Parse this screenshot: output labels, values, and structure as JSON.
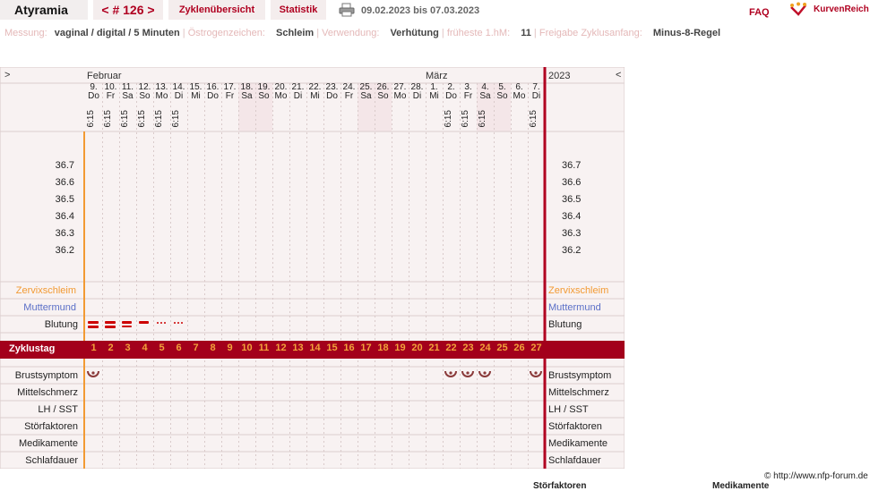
{
  "header": {
    "username": "Atyramia",
    "cycle_label": "< # 126 >",
    "nav_overview": "Zyklenübersicht",
    "nav_stats": "Statistik",
    "date_range": "09.02.2023 bis 07.03.2023",
    "faq": "FAQ",
    "brand": "KurvenReich"
  },
  "meta": [
    {
      "label": "Messung:",
      "value": "vaginal / digital / 5 Minuten"
    },
    {
      "label": "Östrogenzeichen:",
      "value": "Schleim"
    },
    {
      "label": "Verwendung:",
      "value": "Verhütung"
    },
    {
      "label": "früheste 1.hM:",
      "value": "11"
    },
    {
      "label": "Freigabe Zyklusanfang:",
      "value": "Minus-8-Regel"
    }
  ],
  "chart": {
    "nav_left": ">",
    "nav_right": "<",
    "month_feb": "Februar",
    "month_mar": "März",
    "year": "2023",
    "temp_labels": [
      "36.7",
      "36.6",
      "36.5",
      "36.4",
      "36.3",
      "36.2"
    ],
    "row_labels": {
      "zervix": "Zervixschleim",
      "mumu": "Muttermund",
      "blutung": "Blutung",
      "zyklustag": "Zyklustag",
      "brust": "Brustsymptom",
      "mittel": "Mittelschmerz",
      "lh": "LH / SST",
      "stoer": "Störfaktoren",
      "medi": "Medikamente",
      "schlaf": "Schlafdauer"
    },
    "colors": {
      "accent": "#b00020",
      "cycle_bar": "#a3001b",
      "weekend": "#f4e6e8",
      "orange": "#f29a33",
      "blue": "#5a6fc7"
    }
  },
  "days": [
    {
      "d": "9.",
      "w": "Do",
      "t": "6:15",
      "n": "1",
      "we": false,
      "bl": "heavy",
      "br": true
    },
    {
      "d": "10.",
      "w": "Fr",
      "t": "6:15",
      "n": "2",
      "we": false,
      "bl": "heavy",
      "br": false
    },
    {
      "d": "11.",
      "w": "Sa",
      "t": "6:15",
      "n": "3",
      "we": false,
      "bl": "medium",
      "br": false
    },
    {
      "d": "12.",
      "w": "So",
      "t": "6:15",
      "n": "4",
      "we": false,
      "bl": "light",
      "br": false
    },
    {
      "d": "13.",
      "w": "Mo",
      "t": "6:15",
      "n": "5",
      "we": false,
      "bl": "spot",
      "br": false
    },
    {
      "d": "14.",
      "w": "Di",
      "t": "6:15",
      "n": "6",
      "we": false,
      "bl": "spot",
      "br": false
    },
    {
      "d": "15.",
      "w": "Mi",
      "t": "",
      "n": "7",
      "we": false,
      "bl": "",
      "br": false
    },
    {
      "d": "16.",
      "w": "Do",
      "t": "",
      "n": "8",
      "we": false,
      "bl": "",
      "br": false
    },
    {
      "d": "17.",
      "w": "Fr",
      "t": "",
      "n": "9",
      "we": false,
      "bl": "",
      "br": false
    },
    {
      "d": "18.",
      "w": "Sa",
      "t": "",
      "n": "10",
      "we": true,
      "bl": "",
      "br": false
    },
    {
      "d": "19.",
      "w": "So",
      "t": "",
      "n": "11",
      "we": true,
      "bl": "",
      "br": false
    },
    {
      "d": "20.",
      "w": "Mo",
      "t": "",
      "n": "12",
      "we": false,
      "bl": "",
      "br": false
    },
    {
      "d": "21.",
      "w": "Di",
      "t": "",
      "n": "13",
      "we": false,
      "bl": "",
      "br": false
    },
    {
      "d": "22.",
      "w": "Mi",
      "t": "",
      "n": "14",
      "we": false,
      "bl": "",
      "br": false
    },
    {
      "d": "23.",
      "w": "Do",
      "t": "",
      "n": "15",
      "we": false,
      "bl": "",
      "br": false
    },
    {
      "d": "24.",
      "w": "Fr",
      "t": "",
      "n": "16",
      "we": false,
      "bl": "",
      "br": false
    },
    {
      "d": "25.",
      "w": "Sa",
      "t": "",
      "n": "17",
      "we": true,
      "bl": "",
      "br": false
    },
    {
      "d": "26.",
      "w": "So",
      "t": "",
      "n": "18",
      "we": true,
      "bl": "",
      "br": false
    },
    {
      "d": "27.",
      "w": "Mo",
      "t": "",
      "n": "19",
      "we": false,
      "bl": "",
      "br": false
    },
    {
      "d": "28.",
      "w": "Di",
      "t": "",
      "n": "20",
      "we": false,
      "bl": "",
      "br": false
    },
    {
      "d": "1.",
      "w": "Mi",
      "t": "",
      "n": "21",
      "we": false,
      "bl": "",
      "br": false
    },
    {
      "d": "2.",
      "w": "Do",
      "t": "6:15",
      "n": "22",
      "we": false,
      "bl": "",
      "br": true
    },
    {
      "d": "3.",
      "w": "Fr",
      "t": "6:15",
      "n": "23",
      "we": false,
      "bl": "",
      "br": true
    },
    {
      "d": "4.",
      "w": "Sa",
      "t": "6:15",
      "n": "24",
      "we": true,
      "bl": "",
      "br": true
    },
    {
      "d": "5.",
      "w": "So",
      "t": "",
      "n": "25",
      "we": true,
      "bl": "",
      "br": false
    },
    {
      "d": "6.",
      "w": "Mo",
      "t": "",
      "n": "26",
      "we": false,
      "bl": "",
      "br": false
    },
    {
      "d": "7.",
      "w": "Di",
      "t": "6:15",
      "n": "27",
      "we": false,
      "bl": "",
      "br": true
    }
  ],
  "footer": {
    "copyright": "© http://www.nfp-forum.de",
    "cut1": "Störfaktoren",
    "cut2": "Medikamente"
  }
}
